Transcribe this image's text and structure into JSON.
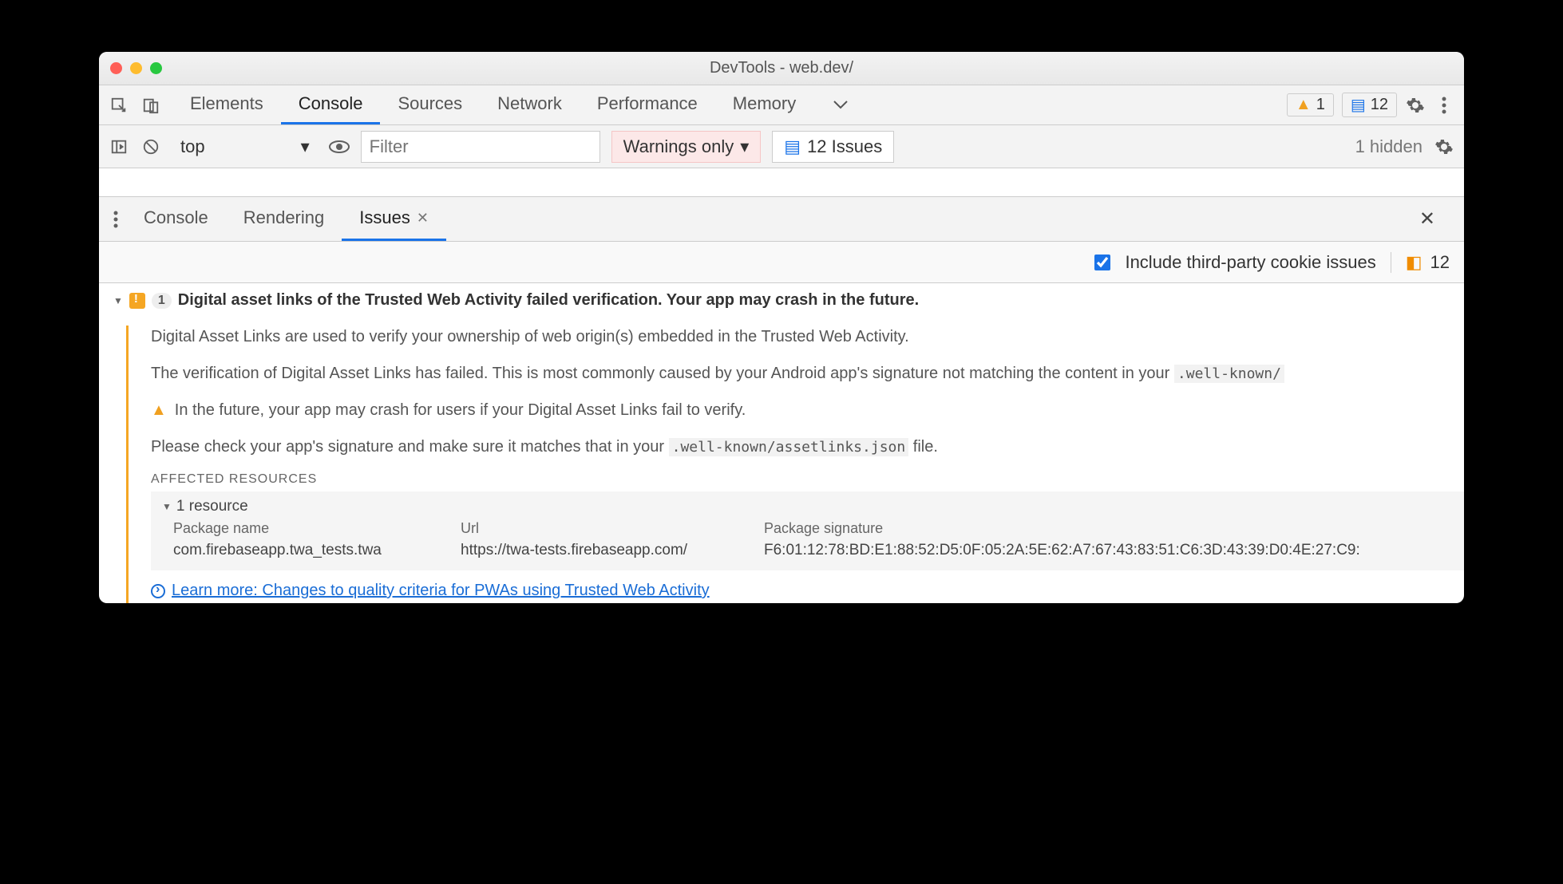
{
  "window": {
    "title": "DevTools - web.dev/"
  },
  "mainTabs": [
    "Elements",
    "Console",
    "Sources",
    "Network",
    "Performance",
    "Memory"
  ],
  "activeMainTab": "Console",
  "badges": {
    "warnings": "1",
    "issues": "12"
  },
  "filterBar": {
    "context": "top",
    "filterPlaceholder": "Filter",
    "levels": "Warnings only",
    "issuesButton": "12 Issues",
    "hidden": "1 hidden"
  },
  "drawerTabs": {
    "console": "Console",
    "rendering": "Rendering",
    "issues": "Issues"
  },
  "issuesToolbar": {
    "checkboxLabel": "Include third-party cookie issues",
    "count": "12"
  },
  "issue": {
    "count": "1",
    "title": "Digital asset links of the Trusted Web Activity failed verification. Your app may crash in the future.",
    "p1": "Digital Asset Links are used to verify your ownership of web origin(s) embedded in the Trusted Web Activity.",
    "p2_a": "The verification of Digital Asset Links has failed. This is most commonly caused by your Android app's signature not matching the content in your ",
    "p2_code": ".well-known/",
    "p3": "In the future, your app may crash for users if your Digital Asset Links fail to verify.",
    "p4_a": "Please check your app's signature and make sure it matches that in your ",
    "p4_code": ".well-known/assetlinks.json",
    "p4_b": " file.",
    "affectedLabel": "AFFECTED RESOURCES",
    "resourceCount": "1 resource",
    "columns": {
      "package": "Package name",
      "url": "Url",
      "sig": "Package signature"
    },
    "row": {
      "package": "com.firebaseapp.twa_tests.twa",
      "url": "https://twa-tests.firebaseapp.com/",
      "sig": "F6:01:12:78:BD:E1:88:52:D5:0F:05:2A:5E:62:A7:67:43:83:51:C6:3D:43:39:D0:4E:27:C9:"
    },
    "learnMore": "Learn more: Changes to quality criteria for PWAs using Trusted Web Activity"
  }
}
